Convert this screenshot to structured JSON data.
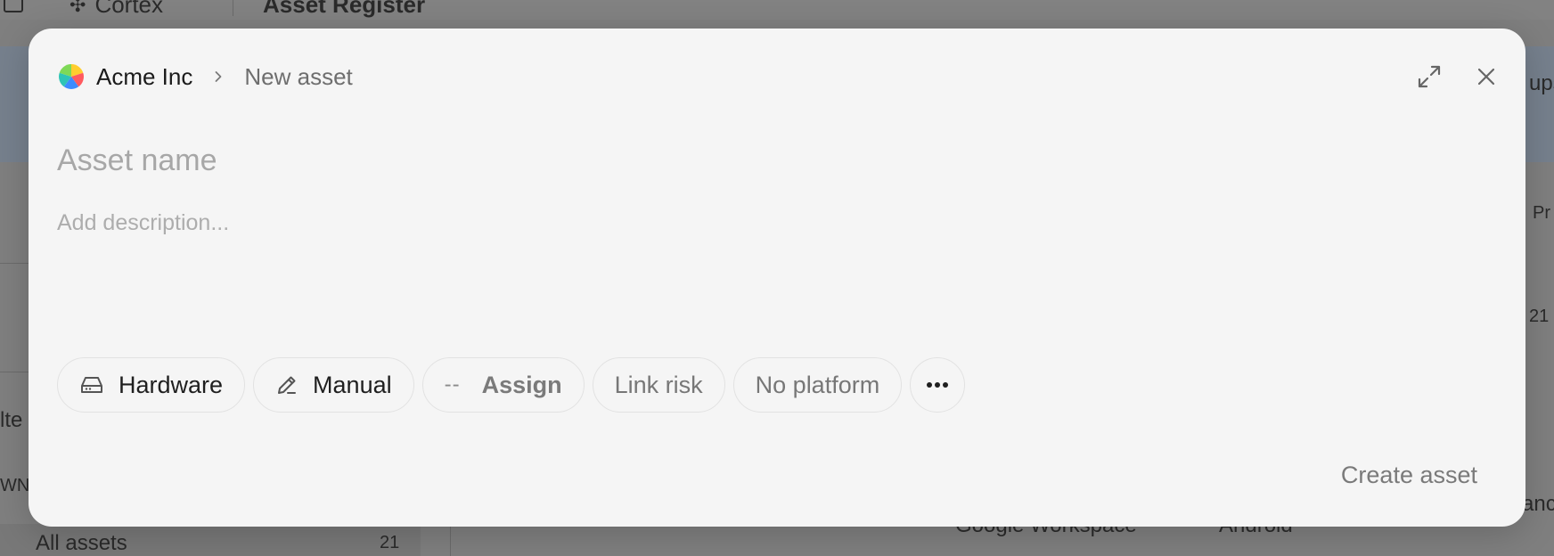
{
  "background": {
    "brand": "Cortex",
    "page_title": "Asset Register",
    "right_fragment_top": "ups",
    "right_fragment_col": "Pr",
    "right_fragment_num": "21",
    "left_fragment_a": "lte",
    "left_fragment_b": "WN",
    "sidebar_item_label": "All assets",
    "sidebar_item_count": "21",
    "row_platform": "Google Workspace",
    "row_os": "Android",
    "right_fragment_bottom": "anc"
  },
  "modal": {
    "org_name": "Acme Inc",
    "breadcrumb_current": "New asset",
    "name_placeholder": "Asset name",
    "description_placeholder": "Add description...",
    "chips": {
      "type": "Hardware",
      "source": "Manual",
      "assign_prefix": "--",
      "assign": "Assign",
      "risk": "Link risk",
      "platform": "No platform"
    },
    "create_label": "Create asset"
  },
  "colors": {
    "modal_bg": "#f5f5f5",
    "overlay": "#7f7f7f",
    "muted_text": "#7a7a7a",
    "logo": [
      "#ffcd2e",
      "#ff5a5f",
      "#3d8bff",
      "#2ec4b6",
      "#7ed957"
    ]
  },
  "icons": {
    "org_logo": "pinwheel-logo",
    "breadcrumb_separator": "chevron-right-icon",
    "expand": "expand-icon",
    "close": "close-icon",
    "hardware": "hard-drive-icon",
    "manual": "pencil-icon",
    "more": "more-horizontal-icon"
  }
}
